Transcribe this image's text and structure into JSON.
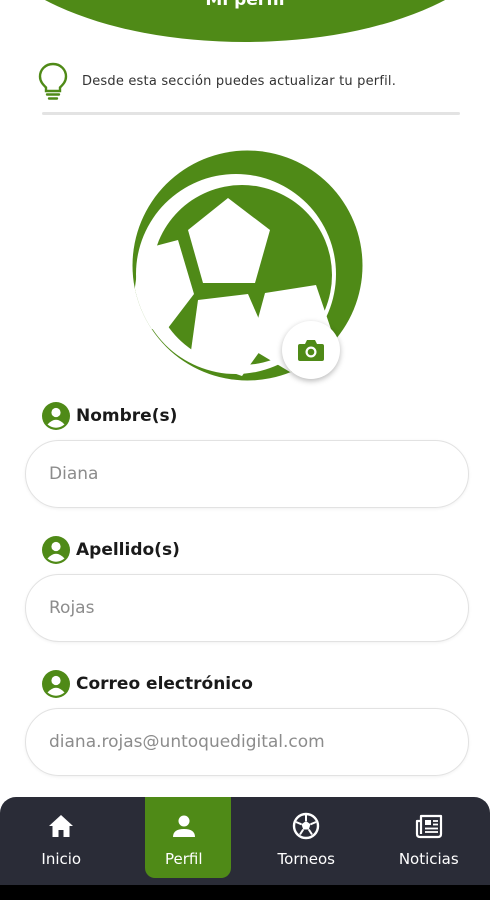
{
  "header": {
    "title": "Mi perfil"
  },
  "info": {
    "text": "Desde esta sección puedes actualizar tu perfil.",
    "icon": "lightbulb-icon"
  },
  "avatar": {
    "icon": "soccer-ball-icon",
    "camera_icon": "camera-icon"
  },
  "fields": {
    "nombre": {
      "label": "Nombre(s)",
      "value": "Diana"
    },
    "apellido": {
      "label": "Apellido(s)",
      "value": "Rojas"
    },
    "correo": {
      "label": "Correo electrónico",
      "value": "diana.rojas@untoquedigital.com"
    }
  },
  "nav": {
    "active": "Perfil",
    "items": [
      {
        "label": "Inicio",
        "icon": "home-icon"
      },
      {
        "label": "Perfil",
        "icon": "person-icon"
      },
      {
        "label": "Torneos",
        "icon": "soccer-ball-icon"
      },
      {
        "label": "Noticias",
        "icon": "newspaper-icon"
      }
    ]
  },
  "colors": {
    "accent": "#4f8a17",
    "nav_bg": "#2a2c37",
    "text": "#1a1a1a",
    "placeholder": "#8c8c8c"
  }
}
